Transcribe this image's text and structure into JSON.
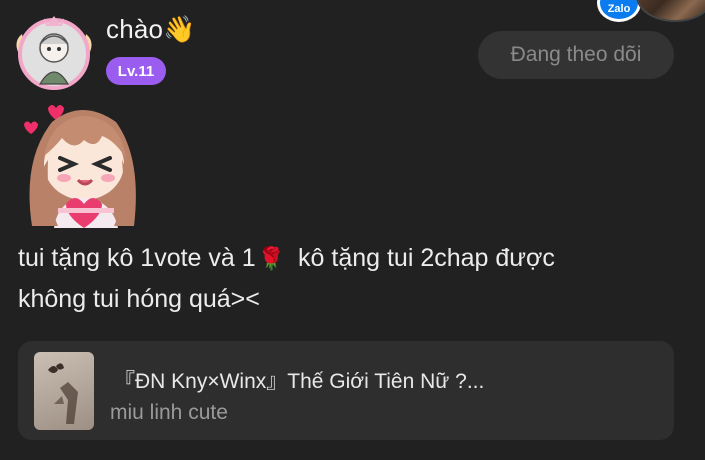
{
  "post": {
    "username": "chào",
    "wave_emoji": "👋",
    "level": "Lv.11",
    "follow_label": "Đang theo dõi",
    "comment_line1_a": "tui tặng kô 1vote và 1",
    "rose_emoji": "🌹",
    "comment_line1_b": " kô tặng tui 2chap được",
    "comment_line2": "không tui hóng quá><"
  },
  "top_right": {
    "zalo_label": "Zalo"
  },
  "story": {
    "title": "『ĐN Kny×Winx』Thế Giới Tiên Nữ ?...",
    "author": "miu linh cute"
  },
  "colors": {
    "background": "#212121",
    "badge": "#9b5cf0",
    "follow_bg": "#333333",
    "card_bg": "#2e2e2e"
  }
}
